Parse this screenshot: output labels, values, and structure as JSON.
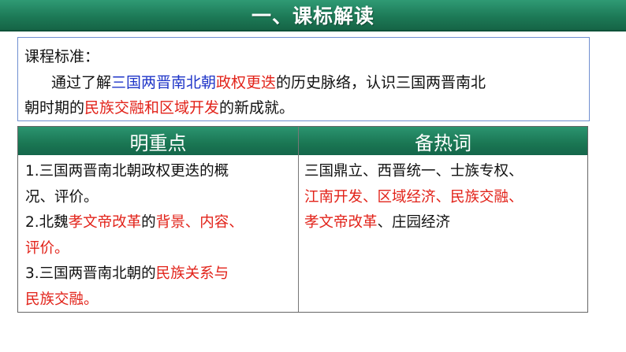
{
  "banner": {
    "title": "一、课标解读"
  },
  "standard": {
    "label": "课程标准：",
    "line1": {
      "prefix": "通过了解",
      "blue": "三国两晋南北朝",
      "red": "政权更迭",
      "suffix": "的历史脉络，认识三国两晋南北"
    },
    "line2": {
      "prefix": "朝时期的",
      "red": "民族交融和区域开发",
      "suffix": "的新成就。"
    }
  },
  "table": {
    "headers": {
      "left": "明重点",
      "right": "备热词"
    },
    "left": {
      "item1_line1": "1.三国两晋南北朝政权更迭的概",
      "item1_line2": "况、评价。",
      "item2_prefix": "2.北魏",
      "item2_red1": "孝文帝改革",
      "item2_mid": "的",
      "item2_red2": "背景、内容、",
      "item2_line2_red": "评价。",
      "item3_prefix": "3.三国两晋南北朝的",
      "item3_red": "民族关系与",
      "item3_line2_red": "民族交融。"
    },
    "right": {
      "line1": "三国鼎立、西晋统一、士族专权、",
      "line2_red": "江南开发、区域经济、民族交融、",
      "line3_red": "孝文帝改革",
      "line3_suffix": "、庄园经济"
    }
  },
  "colors": {
    "banner_green": "#1d7a57",
    "highlight_red": "#e2231a",
    "highlight_blue": "#1f35c8",
    "box_border": "#6f8fd0"
  }
}
